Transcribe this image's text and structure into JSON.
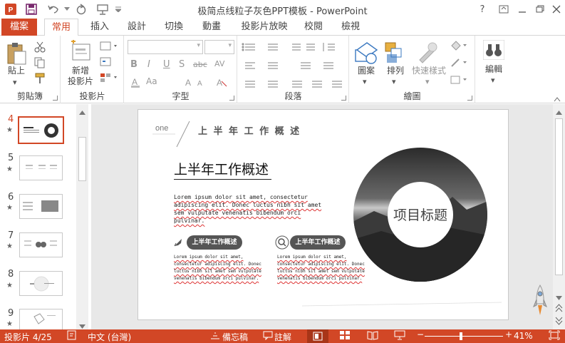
{
  "window": {
    "title": "极简点线粒子灰色PPT模板 - PowerPoint",
    "help": "?"
  },
  "tabs": [
    "檔案",
    "常用",
    "插入",
    "設計",
    "切換",
    "動畫",
    "投影片放映",
    "校閱",
    "檢視"
  ],
  "ribbon": {
    "clipboard": {
      "label": "剪貼簿",
      "paste": "貼上"
    },
    "slides": {
      "label": "投影片",
      "new_slide_1": "新增",
      "new_slide_2": "投影片"
    },
    "font": {
      "label": "字型",
      "bold": "B",
      "italic": "I",
      "underline": "U",
      "shadow": "S",
      "strike": "abc",
      "spacing": "AV",
      "case": "Aa"
    },
    "paragraph": {
      "label": "段落"
    },
    "drawing": {
      "label": "繪圖",
      "shapes": "圖案",
      "arrange": "排列",
      "quick_styles": "快速樣式"
    },
    "editing": {
      "label": "編輯"
    }
  },
  "thumbnails": [
    {
      "number": "4",
      "star": "★"
    },
    {
      "number": "5",
      "star": "★"
    },
    {
      "number": "6",
      "star": "★"
    },
    {
      "number": "7",
      "star": "★"
    },
    {
      "number": "8",
      "star": "★"
    },
    {
      "number": "9",
      "star": "★"
    }
  ],
  "slide": {
    "one": "one",
    "header": "上 半 年 工 作 概 述",
    "title": "上半年工作概述",
    "para_lines": [
      "Lorem ipsum dolor sit amet, consectetur",
      "adipiscing elit. Donec luctus nibh sit amet",
      "sem vulputate venenatis bibendum orci",
      "pulvinar."
    ],
    "pill_left": "上半年工作概述",
    "pill_right": "上半年工作概述",
    "small_left": [
      "Lorem ipsum dolor sit amet,",
      "consectetur adipiscing elit. Donec",
      "luctus nibh sit amet sem vulputate",
      "venenatis bibendum orci pulvinar."
    ],
    "small_right": [
      "Lorem ipsum dolor sit amet,",
      "consectetur adipiscing elit. Donec",
      "luctus nibh sit amet sem vulputate",
      "venenatis bibendum orci pulvinar."
    ],
    "circle_text": "项目标题"
  },
  "status": {
    "slide_info": "投影片 4/25",
    "language": "中文 (台灣)",
    "notes": "備忘稿",
    "comments": "註解",
    "zoom": "41%",
    "minus": "−",
    "plus": "+"
  }
}
